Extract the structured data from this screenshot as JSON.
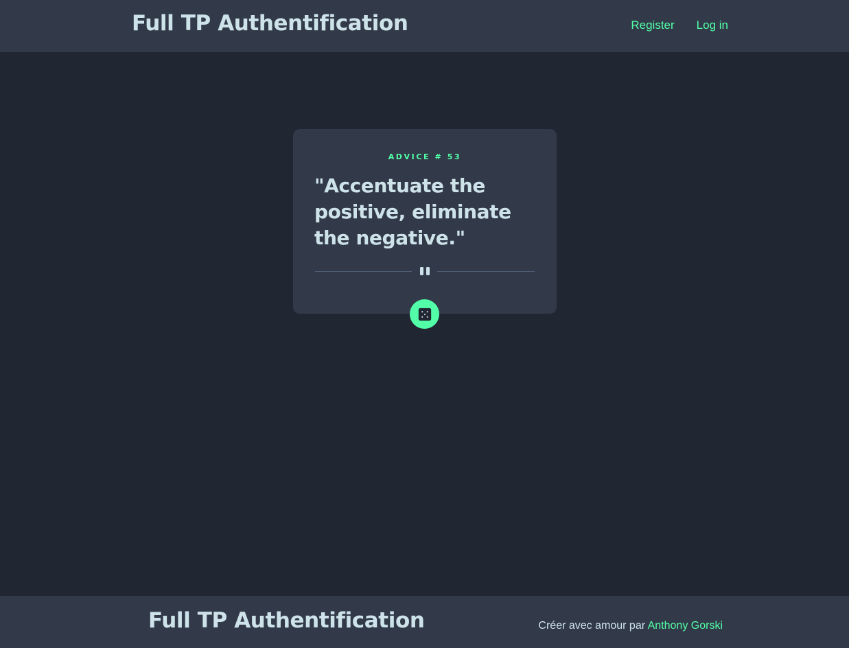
{
  "header": {
    "brand": "Full TP Authentification",
    "nav": [
      {
        "label": "Register"
      },
      {
        "label": "Log in"
      }
    ]
  },
  "advice": {
    "id_label": "ADVICE # 53",
    "quote": "\"Accentuate the positive, eliminate the negative.\""
  },
  "icons": {
    "divider": "pause-icon",
    "generate": "dice-icon"
  },
  "footer": {
    "brand": "Full TP Authentification",
    "credit_prefix": "Créer avec amour par ",
    "credit_author": "Anthony Gorski"
  },
  "colors": {
    "accent": "#52ffa8",
    "background": "#202632",
    "surface": "#323a49",
    "text": "#cee3e9",
    "divider": "#4f5d74"
  }
}
